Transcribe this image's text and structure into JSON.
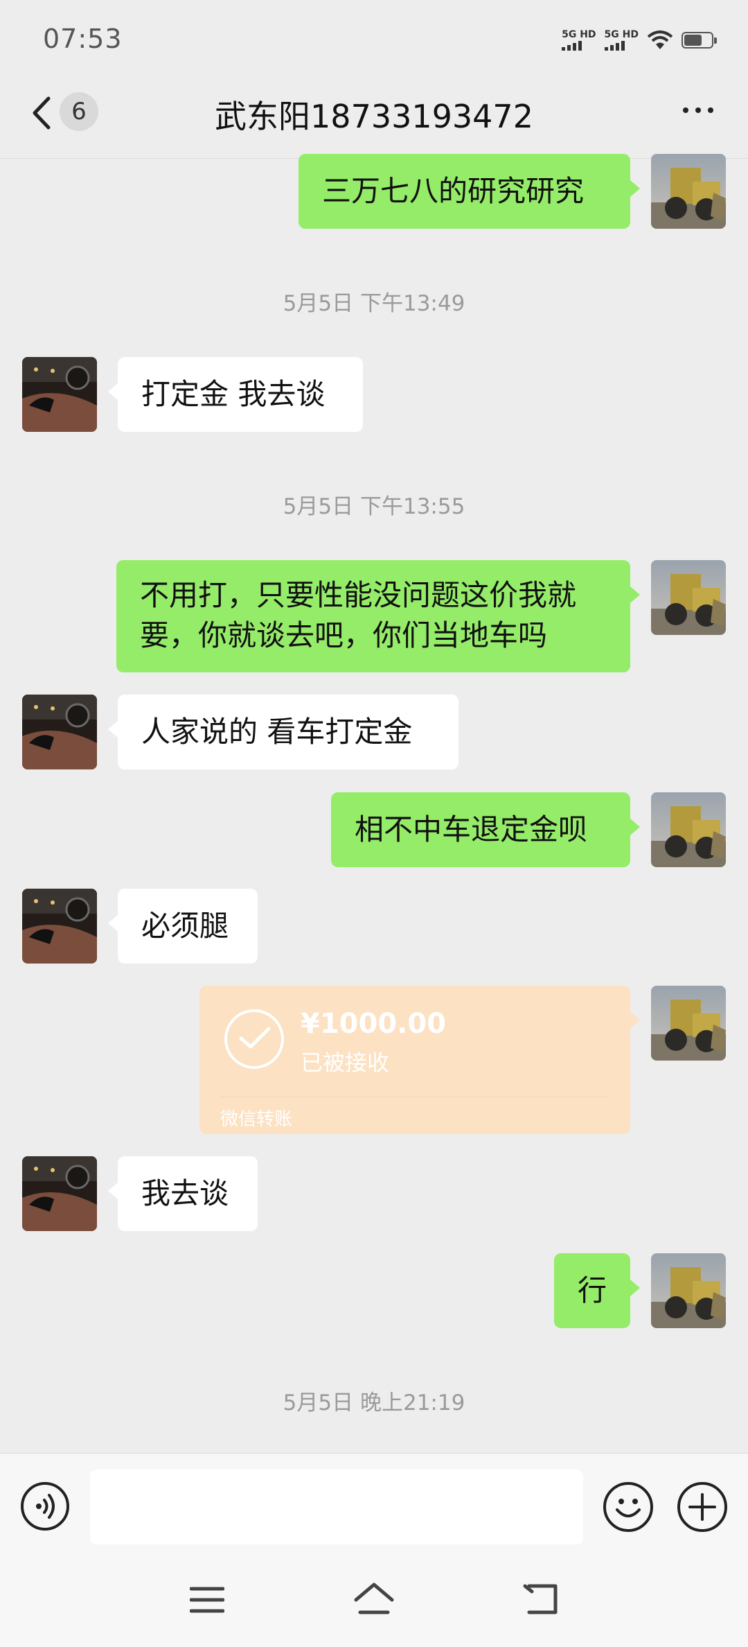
{
  "status_bar": {
    "time": "07:53",
    "sim1": "5G HD",
    "sim2": "5G HD"
  },
  "header": {
    "unread_count": "6",
    "title": "武东阳18733193472"
  },
  "messages": {
    "m1": "三万七八的研究研究",
    "t1": "5月5日 下午13:49",
    "m2": "打定金 我去谈",
    "t2": "5月5日 下午13:55",
    "m3_line1": "不用打，只要性能没问题这价我就",
    "m3_line2": "要，你就谈去吧，你们当地车吗",
    "m4": "人家说的 看车打定金",
    "m5": "相不中车退定金呗",
    "m6": "必须腿",
    "transfer": {
      "amount": "¥1000.00",
      "status": "已被接收",
      "source": "微信转账"
    },
    "m7": "我去谈",
    "m8": "行",
    "t3": "5月5日 晚上21:19"
  },
  "icons": {
    "back": "chevron-left-icon",
    "more": "more-dots-icon",
    "voice": "voice-icon",
    "emoji": "emoji-icon",
    "plus": "plus-icon",
    "menu": "menu-icon",
    "home": "home-icon",
    "return": "back-nav-icon"
  },
  "colors": {
    "outgoing_bubble": "#95ec69",
    "incoming_bubble": "#ffffff",
    "transfer_card": "#fce1c3",
    "background": "#ededed"
  }
}
